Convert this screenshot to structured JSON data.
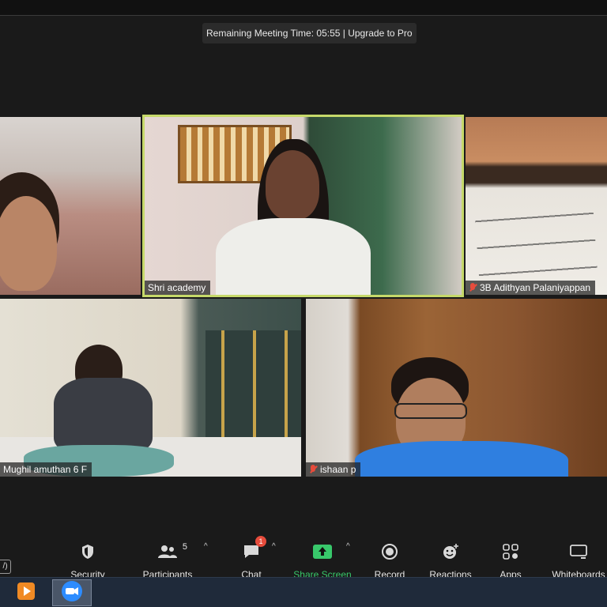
{
  "meeting": {
    "timer_text": "Remaining Meeting Time: 05:55 | Upgrade to Pro"
  },
  "participants": [
    {
      "name": "",
      "muted": false
    },
    {
      "name": "Shri academy",
      "muted": false,
      "active_speaker": true
    },
    {
      "name": "3B Adithyan Palaniyappan",
      "muted": true
    },
    {
      "name": "Mughil amuthan 6 F",
      "muted": false
    },
    {
      "name": "ishaan p",
      "muted": true
    }
  ],
  "toolbar": {
    "left_stub": "/)",
    "security": {
      "label": "Security",
      "icon": "shield-icon"
    },
    "participants": {
      "label": "Participants",
      "count": "5",
      "icon": "people-icon"
    },
    "chat": {
      "label": "Chat",
      "badge": "1",
      "icon": "chat-bubble-icon"
    },
    "share_screen": {
      "label": "Share Screen",
      "icon": "share-arrow-icon",
      "color": "#38c86b"
    },
    "record": {
      "label": "Record",
      "icon": "record-icon"
    },
    "reactions": {
      "label": "Reactions",
      "icon": "smiley-plus-icon"
    },
    "apps": {
      "label": "Apps",
      "icon": "apps-icon"
    },
    "whiteboards": {
      "label": "Whiteboards",
      "icon": "whiteboard-icon"
    }
  },
  "taskbar": {
    "apps": [
      {
        "icon": "media-player-icon",
        "active": false
      },
      {
        "icon": "zoom-camera-icon",
        "active": true
      }
    ]
  },
  "colors": {
    "active_border": "#c6d96a",
    "muted": "#e74c3c",
    "accent_green": "#38c86b",
    "zoom_blue": "#2d8cff"
  }
}
